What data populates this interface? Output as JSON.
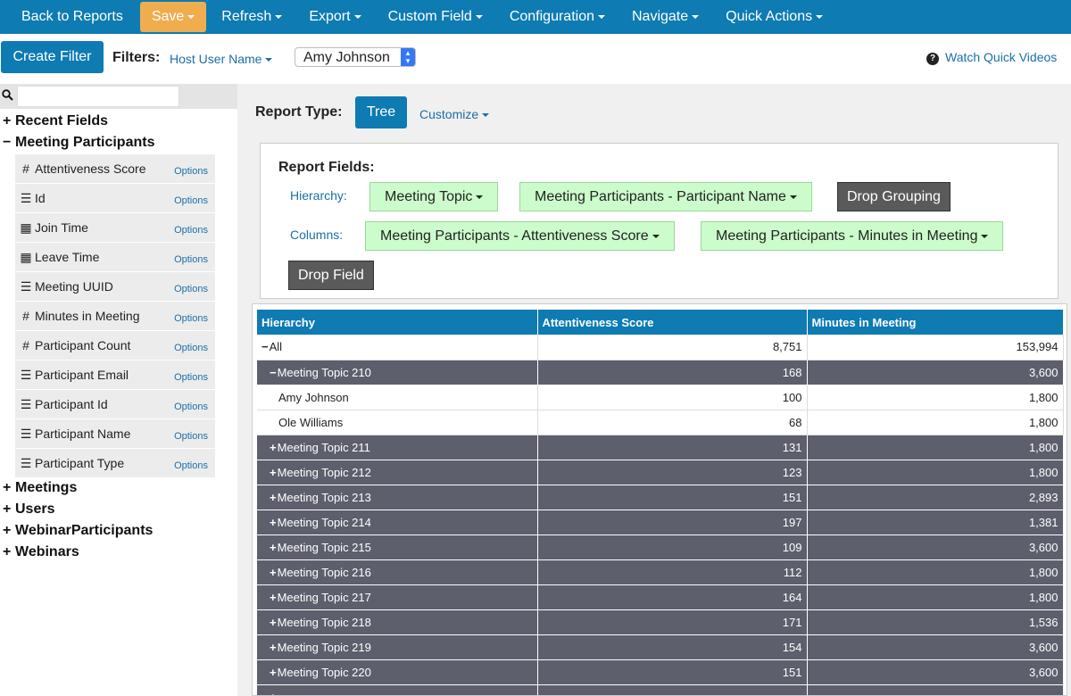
{
  "nav": {
    "items": [
      {
        "label": "Back to Reports",
        "caret": false
      },
      {
        "label": "Save",
        "caret": true
      },
      {
        "label": "Refresh",
        "caret": true
      },
      {
        "label": "Export",
        "caret": true
      },
      {
        "label": "Custom Field",
        "caret": true
      },
      {
        "label": "Configuration",
        "caret": true
      },
      {
        "label": "Navigate",
        "caret": true
      },
      {
        "label": "Quick Actions",
        "caret": true
      }
    ],
    "accent": "#0e7bb2",
    "save_color": "#f0ad4e"
  },
  "filterbar": {
    "create_filter_label": "Create Filter",
    "filters_label": "Filters:",
    "filter_field": "Host User Name",
    "filter_value": "Amy Johnson",
    "quick_videos_label": "Watch Quick Videos"
  },
  "sidebar": {
    "search_placeholder": "",
    "groups_top": [
      {
        "sign": "+",
        "label": "Recent Fields"
      },
      {
        "sign": "−",
        "label": "Meeting Participants"
      }
    ],
    "fields": [
      {
        "icon": "hash-icon",
        "glyph": "#",
        "name": "Attentiveness Score",
        "options": "Options"
      },
      {
        "icon": "list-icon",
        "glyph": "☰",
        "name": "Id",
        "options": "Options"
      },
      {
        "icon": "calendar-icon",
        "glyph": "▦",
        "name": "Join Time",
        "options": "Options"
      },
      {
        "icon": "calendar-icon",
        "glyph": "▦",
        "name": "Leave Time",
        "options": "Options"
      },
      {
        "icon": "list-icon",
        "glyph": "☰",
        "name": "Meeting UUID",
        "options": "Options"
      },
      {
        "icon": "hash-icon",
        "glyph": "#",
        "name": "Minutes in Meeting",
        "options": "Options"
      },
      {
        "icon": "hash-icon",
        "glyph": "#",
        "name": "Participant Count",
        "options": "Options"
      },
      {
        "icon": "list-icon",
        "glyph": "☰",
        "name": "Participant Email",
        "options": "Options"
      },
      {
        "icon": "list-icon",
        "glyph": "☰",
        "name": "Participant Id",
        "options": "Options"
      },
      {
        "icon": "list-icon",
        "glyph": "☰",
        "name": "Participant Name",
        "options": "Options"
      },
      {
        "icon": "list-icon",
        "glyph": "☰",
        "name": "Participant Type",
        "options": "Options"
      }
    ],
    "groups_bottom": [
      {
        "sign": "+",
        "label": "Meetings"
      },
      {
        "sign": "+",
        "label": "Users"
      },
      {
        "sign": "+",
        "label": "WebinarParticipants"
      },
      {
        "sign": "+",
        "label": "Webinars"
      }
    ]
  },
  "report": {
    "type_label": "Report Type:",
    "type_button": "Tree",
    "customize_label": "Customize",
    "fields_title": "Report Fields:",
    "hierarchy_label": "Hierarchy:",
    "columns_label": "Columns:",
    "hierarchy_fields": [
      "Meeting Topic",
      "Meeting Participants - Participant Name"
    ],
    "drop_grouping": "Drop Grouping",
    "column_fields": [
      "Meeting Participants - Attentiveness Score",
      "Meeting Participants - Minutes in Meeting"
    ],
    "drop_field": "Drop Field",
    "pill_color": "#ccfccc",
    "dark_row_color": "#5e5f6d"
  },
  "table": {
    "headers": [
      "Hierarchy",
      "Attentiveness Score",
      "Minutes in Meeting"
    ],
    "rows": [
      {
        "kind": "light",
        "indent": 0,
        "sign": "−",
        "label": "All",
        "score": "8,751",
        "minutes": "153,994"
      },
      {
        "kind": "dark",
        "indent": 1,
        "sign": "−",
        "label": "Meeting Topic 210",
        "score": "168",
        "minutes": "3,600"
      },
      {
        "kind": "light",
        "indent": 2,
        "sign": "",
        "label": "Amy Johnson",
        "score": "100",
        "minutes": "1,800"
      },
      {
        "kind": "light",
        "indent": 2,
        "sign": "",
        "label": "Ole Williams",
        "score": "68",
        "minutes": "1,800"
      },
      {
        "kind": "dark",
        "indent": 1,
        "sign": "+",
        "label": "Meeting Topic 211",
        "score": "131",
        "minutes": "1,800"
      },
      {
        "kind": "dark",
        "indent": 1,
        "sign": "+",
        "label": "Meeting Topic 212",
        "score": "123",
        "minutes": "1,800"
      },
      {
        "kind": "dark",
        "indent": 1,
        "sign": "+",
        "label": "Meeting Topic 213",
        "score": "151",
        "minutes": "2,893"
      },
      {
        "kind": "dark",
        "indent": 1,
        "sign": "+",
        "label": "Meeting Topic 214",
        "score": "197",
        "minutes": "1,381"
      },
      {
        "kind": "dark",
        "indent": 1,
        "sign": "+",
        "label": "Meeting Topic 215",
        "score": "109",
        "minutes": "3,600"
      },
      {
        "kind": "dark",
        "indent": 1,
        "sign": "+",
        "label": "Meeting Topic 216",
        "score": "112",
        "minutes": "1,800"
      },
      {
        "kind": "dark",
        "indent": 1,
        "sign": "+",
        "label": "Meeting Topic 217",
        "score": "164",
        "minutes": "1,800"
      },
      {
        "kind": "dark",
        "indent": 1,
        "sign": "+",
        "label": "Meeting Topic 218",
        "score": "171",
        "minutes": "1,536"
      },
      {
        "kind": "dark",
        "indent": 1,
        "sign": "+",
        "label": "Meeting Topic 219",
        "score": "154",
        "minutes": "3,600"
      },
      {
        "kind": "dark",
        "indent": 1,
        "sign": "+",
        "label": "Meeting Topic 220",
        "score": "151",
        "minutes": "3,600"
      },
      {
        "kind": "dark",
        "indent": 1,
        "sign": "+",
        "label": "",
        "score": "",
        "minutes": ""
      }
    ]
  }
}
